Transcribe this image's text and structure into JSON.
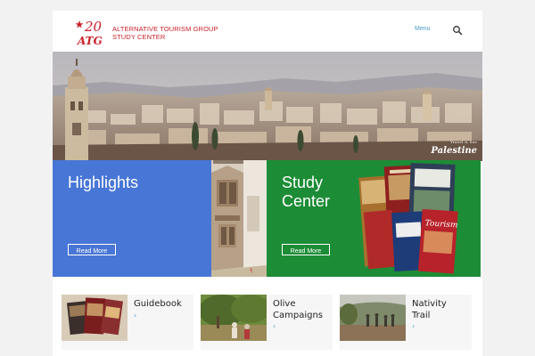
{
  "header": {
    "logo": {
      "mark_number": "20",
      "mark_letters": "ATG",
      "line1": "ALTERNATIVE TOURISM GROUP",
      "line2": "STUDY CENTER"
    },
    "menu_label": "Menu",
    "icons": {
      "search": "search-icon"
    }
  },
  "hero": {
    "badge_small": "Travel & See",
    "badge_title": "Palestine"
  },
  "features": [
    {
      "title": "Highlights",
      "button": "Read More",
      "color": "#4876d6"
    },
    {
      "title_line1": "Study",
      "title_line2": "Center",
      "button": "Read More",
      "color": "#1d8c36"
    }
  ],
  "cards": [
    {
      "title": "Guidebook",
      "arrow": "›"
    },
    {
      "title_line1": "Olive",
      "title_line2": "Campaigns",
      "arrow": "›"
    },
    {
      "title_line1": "Nativity",
      "title_line2": "Trail",
      "arrow": "›"
    }
  ],
  "colors": {
    "brand_red": "#c8202a",
    "link_blue": "#4aa0c8"
  }
}
